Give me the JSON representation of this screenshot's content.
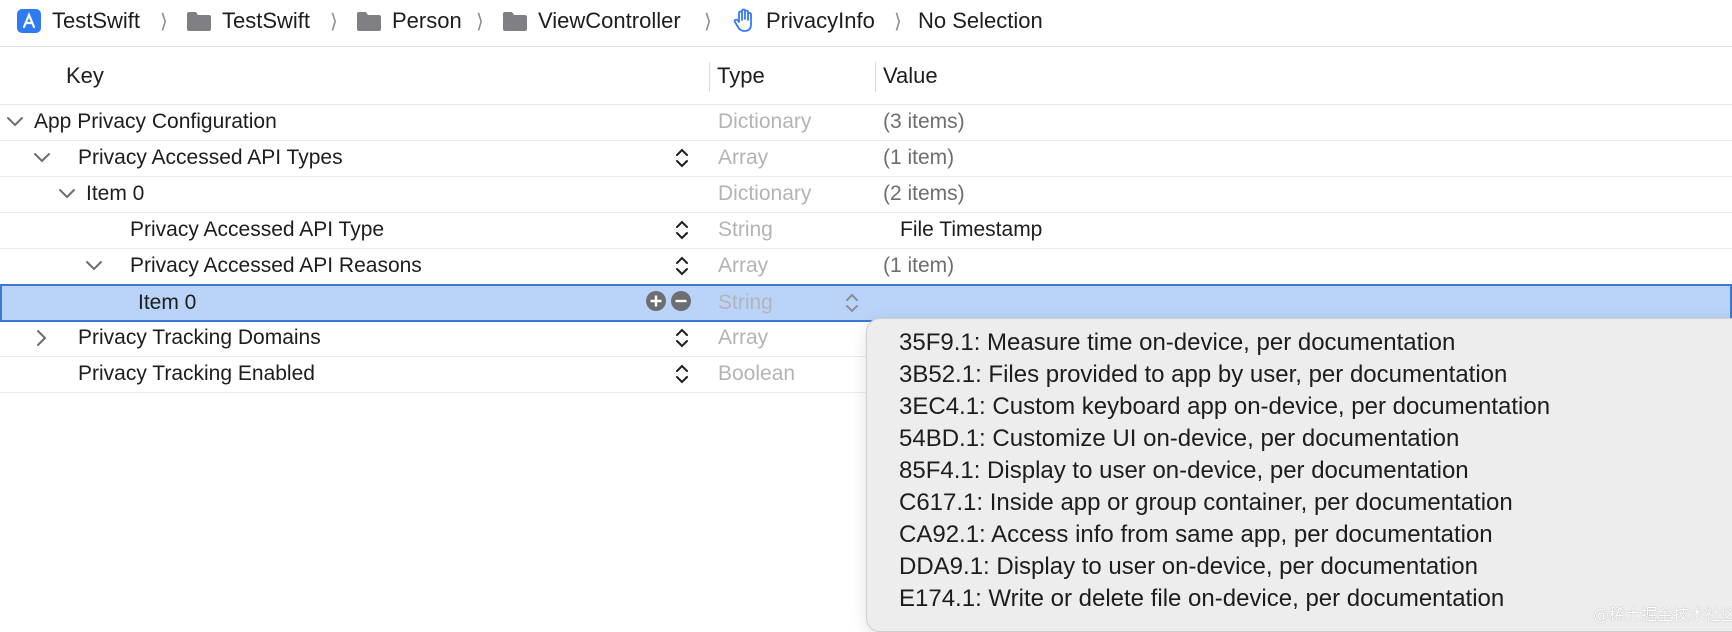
{
  "breadcrumb": {
    "items": [
      {
        "label": "TestSwift",
        "icon": "xcode-project-icon"
      },
      {
        "label": "TestSwift",
        "icon": "folder-icon"
      },
      {
        "label": "Person",
        "icon": "folder-icon"
      },
      {
        "label": "ViewController",
        "icon": "folder-icon"
      },
      {
        "label": "PrivacyInfo",
        "icon": "hand-privacy-icon"
      },
      {
        "label": "No Selection",
        "icon": ""
      }
    ],
    "separator": "⟩"
  },
  "columns": {
    "key": "Key",
    "type": "Type",
    "value": "Value"
  },
  "rows": [
    {
      "key": "App Privacy Configuration",
      "type": "Dictionary",
      "value": "(3 items)"
    },
    {
      "key": "Privacy Accessed API Types",
      "type": "Array",
      "value": "(1 item)"
    },
    {
      "key": "Item 0",
      "type": "Dictionary",
      "value": "(2 items)"
    },
    {
      "key": "Privacy Accessed API Type",
      "type": "String",
      "value": "File Timestamp"
    },
    {
      "key": "Privacy Accessed API Reasons",
      "type": "Array",
      "value": "(1 item)"
    },
    {
      "key": "Item 0",
      "type": "String",
      "value": ""
    },
    {
      "key": "Privacy Tracking Domains",
      "type": "Array",
      "value": ""
    },
    {
      "key": "Privacy Tracking Enabled",
      "type": "Boolean",
      "value": ""
    }
  ],
  "selected_row_index": 5,
  "popup": {
    "options": [
      "35F9.1: Measure time on-device, per documentation",
      "3B52.1: Files provided to app by user, per documentation",
      "3EC4.1: Custom keyboard app on-device, per documentation",
      "54BD.1: Customize UI on-device, per documentation",
      "85F4.1: Display to user on-device, per documentation",
      "C617.1: Inside app or group container, per documentation",
      "CA92.1: Access info from same app, per documentation",
      "DDA9.1: Display to user on-device, per documentation",
      "E174.1: Write or delete file on-device, per documentation"
    ]
  },
  "watermark": "@稀土掘金技术社区",
  "colors": {
    "selection": "#b9d4f8",
    "selection_border": "#3b78d8",
    "accent": "#3478f6"
  }
}
